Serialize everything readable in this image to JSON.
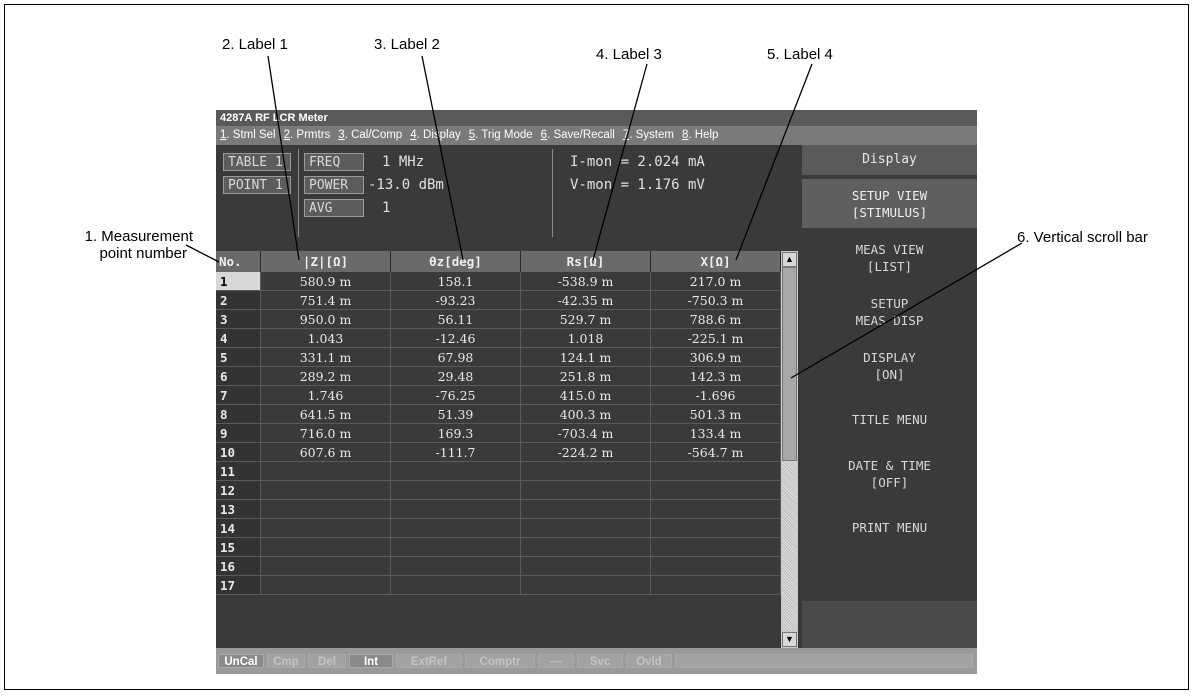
{
  "callouts": {
    "c1_line1": "1. Measurement",
    "c1_line2": "point number",
    "c2": "2. Label 1",
    "c3": "3. Label 2",
    "c4": "4. Label 3",
    "c5": "5. Label 4",
    "c6": "6. Vertical scroll bar"
  },
  "window": {
    "title": "4287A RF LCR Meter"
  },
  "menu": [
    {
      "num": "1",
      "label": ". Stml Sel"
    },
    {
      "num": "2",
      "label": ". Prmtrs"
    },
    {
      "num": "3",
      "label": ". Cal/Comp"
    },
    {
      "num": "4",
      "label": ". Display"
    },
    {
      "num": "5",
      "label": ". Trig Mode"
    },
    {
      "num": "6",
      "label": ". Save/Recall"
    },
    {
      "num": "7",
      "label": ". System"
    },
    {
      "num": "8",
      "label": ". Help"
    }
  ],
  "info": {
    "table_btn": "TABLE 1",
    "point_btn": "POINT 1",
    "freq_btn": "FREQ",
    "freq_val": "1 MHz",
    "power_btn": "POWER",
    "power_val": "-13.0 dBm",
    "avg_btn": "AVG",
    "avg_val": "1",
    "imon": "I-mon = 2.024 mA",
    "vmon": "V-mon = 1.176 mV"
  },
  "softkeys": {
    "title": "Display",
    "items": [
      {
        "l1": "SETUP VIEW",
        "l2": "[STIMULUS]"
      },
      {
        "l1": "MEAS VIEW",
        "l2": "[LIST]"
      },
      {
        "l1": "SETUP",
        "l2": "MEAS DISP"
      },
      {
        "l1": "DISPLAY",
        "l2": "[ON]"
      },
      {
        "l1": "TITLE MENU",
        "l2": ""
      },
      {
        "l1": "DATE & TIME",
        "l2": "[OFF]"
      },
      {
        "l1": "PRINT MENU",
        "l2": ""
      }
    ]
  },
  "table": {
    "headers": [
      "No.",
      "|Z|[Ω]",
      "θz[deg]",
      "Rs[Ω]",
      "X[Ω]"
    ],
    "rows": [
      [
        "1",
        "580.9 m",
        "158.1",
        "-538.9 m",
        "217.0 m"
      ],
      [
        "2",
        "751.4 m",
        "-93.23",
        "-42.35 m",
        "-750.3 m"
      ],
      [
        "3",
        "950.0 m",
        "56.11",
        "529.7 m",
        "788.6 m"
      ],
      [
        "4",
        "1.043",
        "-12.46",
        "1.018",
        "-225.1 m"
      ],
      [
        "5",
        "331.1 m",
        "67.98",
        "124.1 m",
        "306.9 m"
      ],
      [
        "6",
        "289.2 m",
        "29.48",
        "251.8 m",
        "142.3 m"
      ],
      [
        "7",
        "1.746",
        "-76.25",
        "415.0 m",
        "-1.696"
      ],
      [
        "8",
        "641.5 m",
        "51.39",
        "400.3 m",
        "501.3 m"
      ],
      [
        "9",
        "716.0 m",
        "169.3",
        "-703.4 m",
        "133.4 m"
      ],
      [
        "10",
        "607.6 m",
        "-111.7",
        "-224.2 m",
        "-564.7 m"
      ],
      [
        "11",
        "",
        "",
        "",
        ""
      ],
      [
        "12",
        "",
        "",
        "",
        ""
      ],
      [
        "13",
        "",
        "",
        "",
        ""
      ],
      [
        "14",
        "",
        "",
        "",
        ""
      ],
      [
        "15",
        "",
        "",
        "",
        ""
      ],
      [
        "16",
        "",
        "",
        "",
        ""
      ],
      [
        "17",
        "",
        "",
        "",
        ""
      ]
    ]
  },
  "scrollbar": {
    "up_icon": "arrow-up-icon",
    "down_icon": "arrow-down-icon"
  },
  "status": [
    {
      "label": "UnCal",
      "on": true
    },
    {
      "label": "Cmp",
      "on": false
    },
    {
      "label": "Del",
      "on": false
    },
    {
      "label": "Int",
      "on": true
    },
    {
      "label": "ExtRef",
      "on": false
    },
    {
      "label": "Comptr",
      "on": false
    },
    {
      "label": "---",
      "on": false
    },
    {
      "label": "Svc",
      "on": false
    },
    {
      "label": "Ovld",
      "on": false
    }
  ]
}
